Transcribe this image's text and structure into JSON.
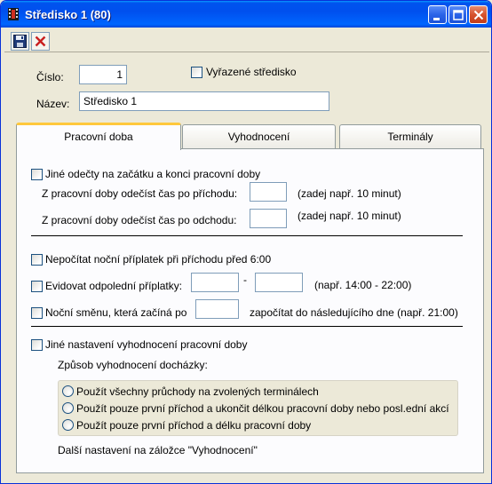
{
  "window": {
    "title": "Středisko 1 (80)",
    "icons": {
      "app": "film-strip-icon",
      "minimize": "minimize-icon",
      "maximize": "maximize-icon",
      "close": "close-icon"
    }
  },
  "toolbar": {
    "save": "save-icon",
    "cancel": "cancel-icon"
  },
  "form": {
    "cislo_label": "Číslo:",
    "cislo_value": "1",
    "vyrazene_label": "Vyřazené středisko",
    "nazev_label": "Název:",
    "nazev_value": "Středisko 1"
  },
  "tabs": [
    {
      "label": "Pracovní doba",
      "active": true
    },
    {
      "label": "Vyhodnocení",
      "active": false
    },
    {
      "label": "Terminály",
      "active": false
    }
  ],
  "panel": {
    "jine_odecty_label": "Jiné odečty na začátku a konci pracovní doby",
    "prichod_label": "Z pracovní doby odečíst čas po příchodu:",
    "prichod_hint": "(zadej např. 10 minut)",
    "odchod_label": "Z pracovní doby odečíst čas po odchodu:",
    "odchod_hint": "(zadej např. 10 minut)",
    "nocni_priplatek_label": "Nepočítat noční příplatek při příchodu před 6:00",
    "odpoledni_label": "Evidovat odpolední příplatky:",
    "odpoledni_dash": "-",
    "odpoledni_hint": "(např. 14:00 - 22:00)",
    "nocni_smena_label": "Noční směnu, která začíná po",
    "nocni_smena_hint": "započítat do následujícího dne (např. 21:00)",
    "jine_nastaveni_label": "Jiné nastavení vyhodnocení pracovní doby",
    "zpusob_label": "Způsob vyhodnocení docházky:",
    "radio_options": [
      "Použít všechny průchody na zvolených terminálech",
      "Použít pouze první příchod a ukončit délkou pracovní doby nebo posl.ední akcí",
      "Použít pouze první příchod a délku pracovní doby"
    ],
    "dalsi_label": "Další nastavení na záložce \"Vyhodnocení\""
  },
  "colors": {
    "titlebar": "#0054e3",
    "window_bg": "#ece9d8",
    "active_tab_accent": "#ffc83c",
    "close_button": "#d6532d"
  }
}
